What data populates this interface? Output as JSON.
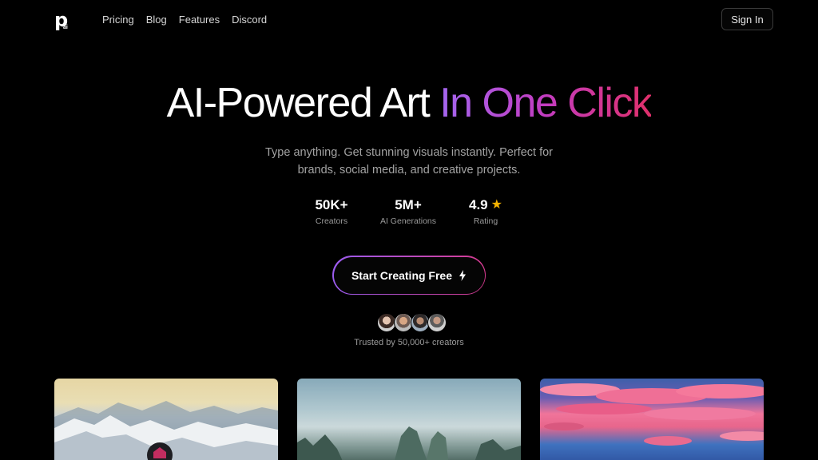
{
  "nav": {
    "logo_letter": "p",
    "logo_sub": "ai",
    "links": [
      "Pricing",
      "Blog",
      "Features",
      "Discord"
    ],
    "signin_label": "Sign In"
  },
  "hero": {
    "title_plain": "AI-Powered Art ",
    "title_gradient": "In One Click",
    "subtitle": "Type anything. Get stunning visuals instantly. Perfect for brands, social media, and creative projects."
  },
  "stats": [
    {
      "value": "50K+",
      "label": "Creators"
    },
    {
      "value": "5M+",
      "label": "AI Generations"
    },
    {
      "value": "4.9",
      "label": "Rating"
    }
  ],
  "cta": {
    "label": "Start Creating Free",
    "icon": "bolt-icon"
  },
  "trust": {
    "text": "Trusted by 50,000+ creators",
    "avatar_count": 4
  },
  "gallery": {
    "cards": [
      "snowy-mountains-image",
      "misty-karst-mountains-image",
      "sunset-clouds-image"
    ]
  },
  "colors": {
    "background": "#000000",
    "gradient_start": "#a466f0",
    "gradient_mid": "#c23cc0",
    "gradient_end": "#e0306b",
    "star": "#f5b301"
  }
}
